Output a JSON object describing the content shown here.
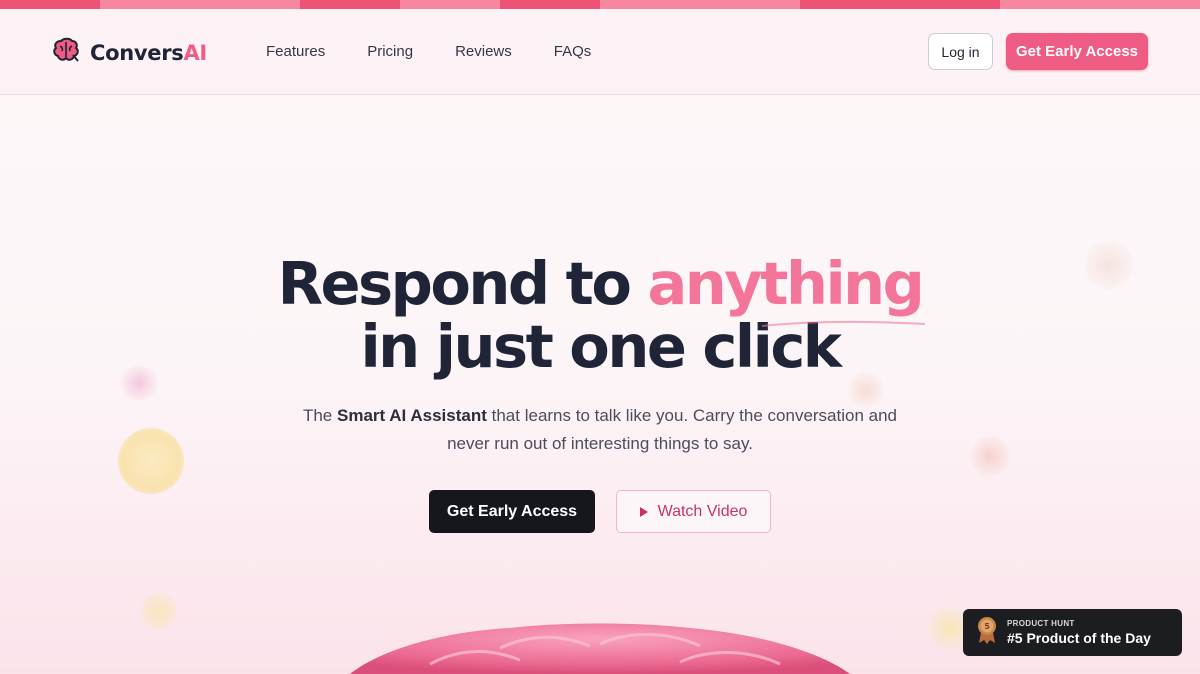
{
  "colors": {
    "accent": "#ee5b83",
    "dark": "#15171d",
    "stripe_light": "#f7879f",
    "stripe_dark": "#ee5275"
  },
  "brand": {
    "name_main": "Convers",
    "name_accent": "AI",
    "icon": "brain-icon"
  },
  "nav": {
    "links": [
      "Features",
      "Pricing",
      "Reviews",
      "FAQs"
    ],
    "login_label": "Log in",
    "cta_label": "Get Early Access"
  },
  "hero": {
    "title_part1": "Respond to ",
    "title_highlight": "anything",
    "title_line2": "in just one click",
    "subtitle_pre": "The ",
    "subtitle_strong": "Smart AI Assistant",
    "subtitle_post": " that learns to talk like you. Carry the conversation and never run out of interesting things to say.",
    "primary_label": "Get Early Access",
    "video_label": "Watch Video",
    "video_icon": "play-icon"
  },
  "product_hunt": {
    "small_label": "PRODUCT HUNT",
    "title": "#5 Product of the Day",
    "medal_number": "5",
    "icon": "medal-icon"
  }
}
